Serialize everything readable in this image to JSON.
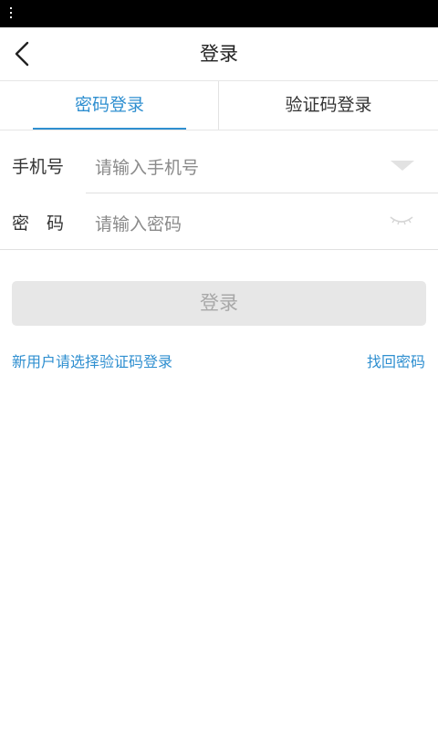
{
  "header": {
    "title": "登录"
  },
  "tabs": [
    {
      "label": "密码登录",
      "active": true
    },
    {
      "label": "验证码登录",
      "active": false
    }
  ],
  "form": {
    "phone": {
      "label": "手机号",
      "placeholder": "请输入手机号",
      "value": ""
    },
    "password": {
      "label": "密　码",
      "placeholder": "请输入密码",
      "value": ""
    }
  },
  "actions": {
    "login_label": "登录",
    "new_user_link": "新用户请选择验证码登录",
    "recover_link": "找回密码"
  },
  "icons": {
    "back": "chevron-left-icon",
    "dropdown": "triangle-down-icon",
    "password_visibility": "eye-closed-icon"
  },
  "colors": {
    "accent": "#2f8fd0",
    "disabled_button_bg": "#e7e7e7",
    "disabled_button_text": "#a8a8a8"
  }
}
